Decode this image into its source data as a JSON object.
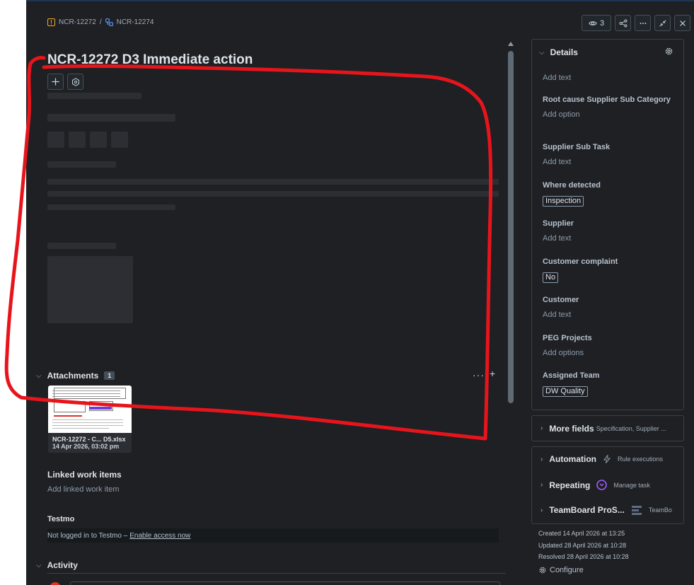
{
  "breadcrumb": {
    "parent": "NCR-12272",
    "separator": "/",
    "child": "NCR-12274"
  },
  "header": {
    "watch_count": "3"
  },
  "issue": {
    "title": "NCR-12272 D3 Immediate action"
  },
  "attachments": {
    "label": "Attachments",
    "count": "1",
    "file_name": "NCR-12272 - C... D5.xlsx",
    "file_date": "14 Apr 2026, 03:02 pm"
  },
  "linked": {
    "label": "Linked work items",
    "placeholder": "Add linked work item"
  },
  "testmo": {
    "label": "Testmo",
    "message": "Not logged in to Testmo –",
    "link": "Enable access now"
  },
  "activity": {
    "label": "Activity"
  },
  "details": {
    "label": "Details",
    "top_value": "Add text",
    "fields": [
      {
        "label": "Root cause Supplier Sub Category",
        "value": "Add option",
        "tag": false
      },
      {
        "label": "Supplier Sub Task",
        "value": "Add text",
        "tag": false
      },
      {
        "label": "Where detected",
        "value": "Inspection",
        "tag": true
      },
      {
        "label": "Supplier",
        "value": "Add text",
        "tag": false
      },
      {
        "label": "Customer complaint",
        "value": "No",
        "tag": true
      },
      {
        "label": "Customer",
        "value": "Add text",
        "tag": false
      },
      {
        "label": "PEG Projects",
        "value": "Add options",
        "tag": false
      },
      {
        "label": "Assigned Team",
        "value": "DW Quality",
        "tag": true
      }
    ]
  },
  "more_fields": {
    "label": "More fields",
    "summary": "Specification, Supplier ..."
  },
  "apps": [
    {
      "label": "Automation",
      "sub": "Rule executions"
    },
    {
      "label": "Repeating",
      "sub": "Manage task"
    },
    {
      "label": "TeamBoard ProS...",
      "sub": "TeamBo"
    }
  ],
  "meta": {
    "created": "Created 14 April 2026 at 13:25",
    "updated": "Updated 28 April 2026 at 10:28",
    "resolved": "Resolved 28 April 2026 at 10:28"
  },
  "configure": {
    "label": "Configure"
  },
  "colors": {
    "panel": "#1f2023",
    "annotation": "#e8141c",
    "accent": "#579dff"
  }
}
